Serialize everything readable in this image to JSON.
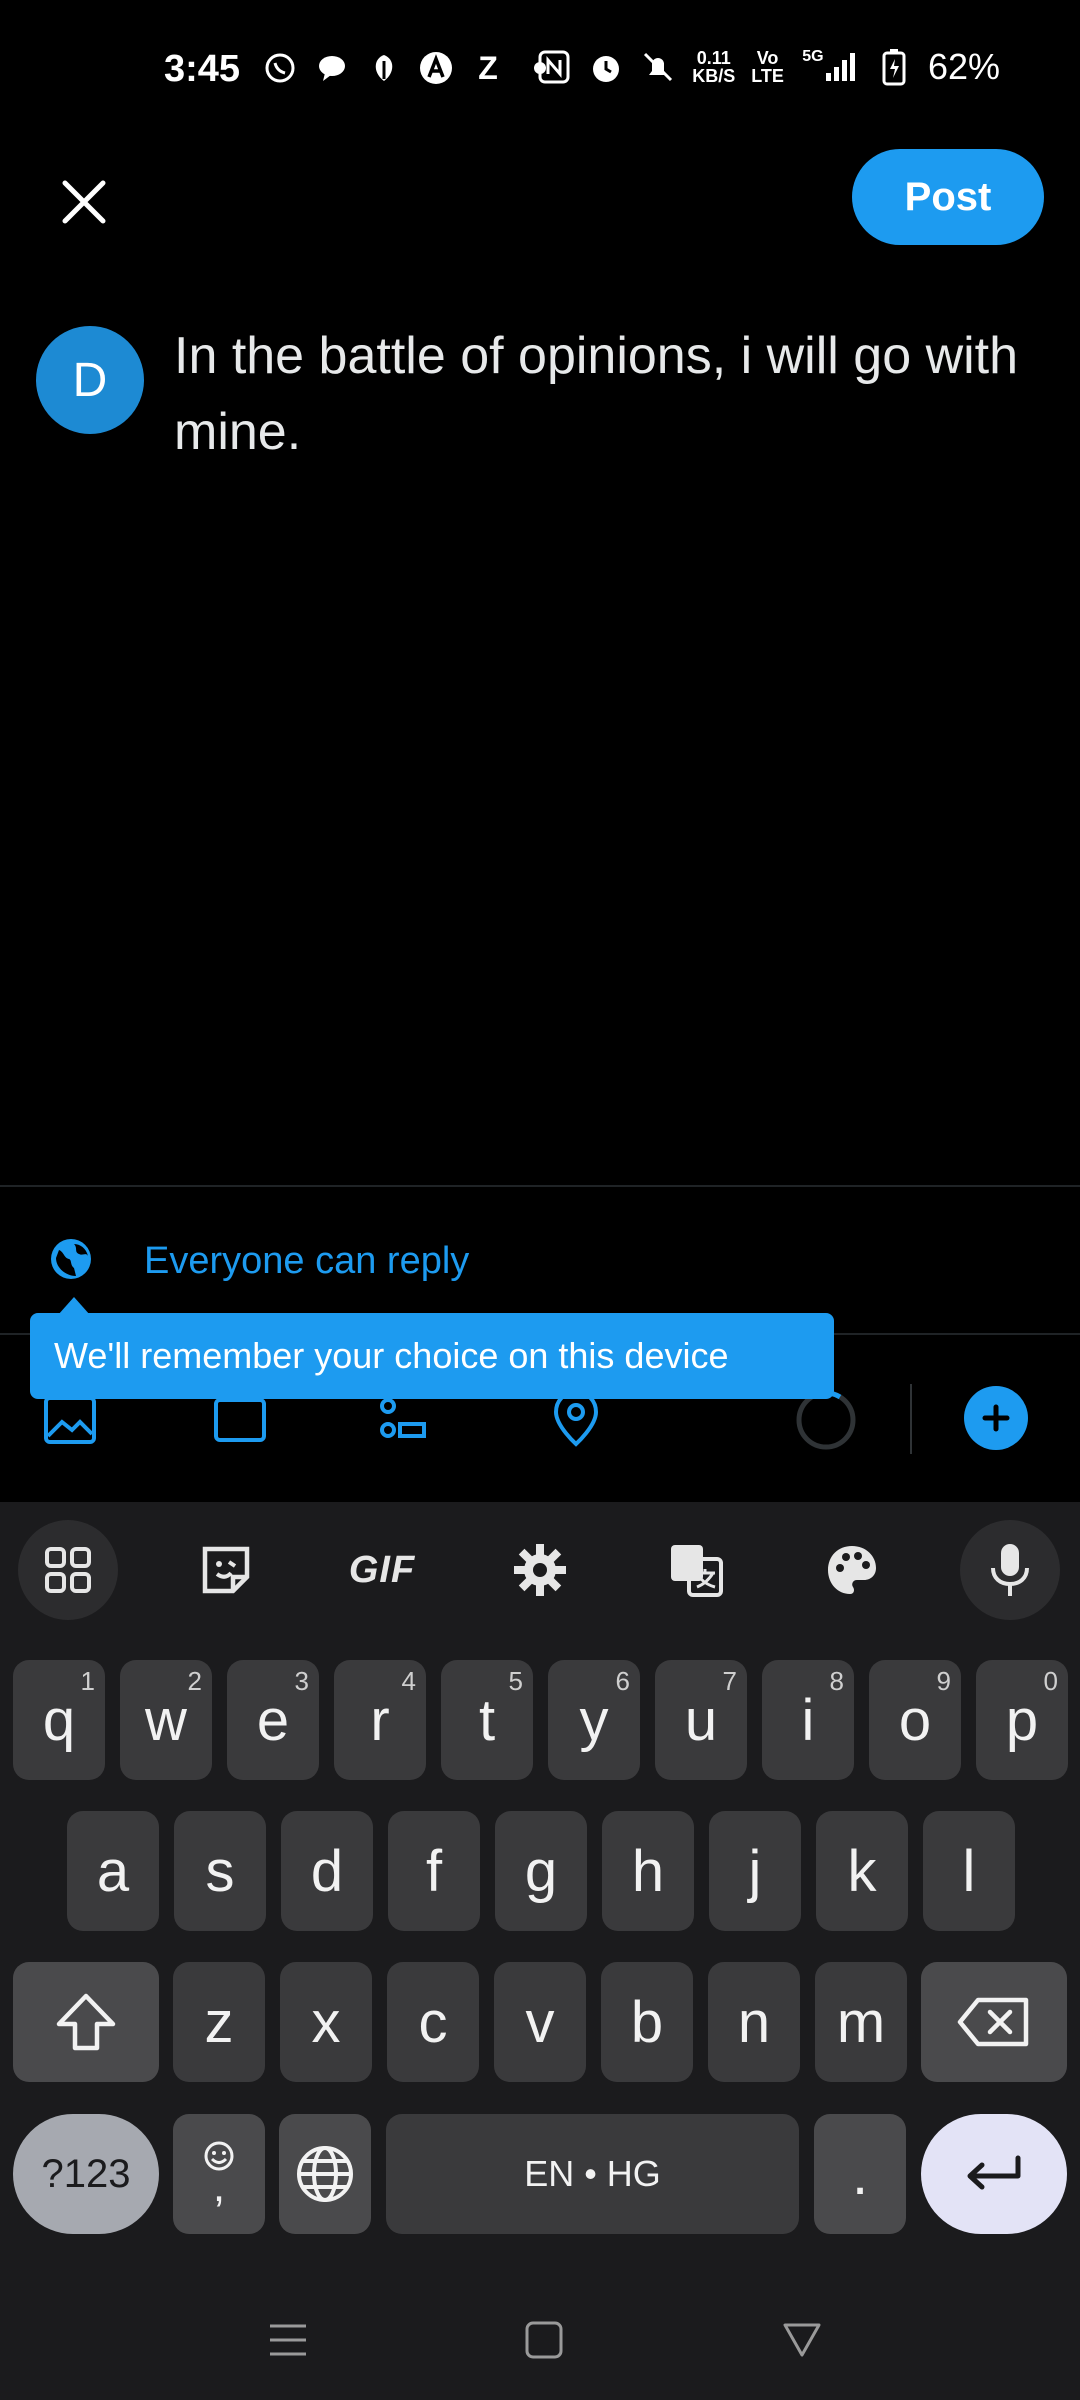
{
  "status_bar": {
    "time": "3:45",
    "left_icons": [
      "whatsapp-icon",
      "chat-bubble-icon",
      "leaf-icon",
      "a-logo-icon",
      "z-letter-icon",
      "dot-icon"
    ],
    "right_icons": [
      "nfc-icon",
      "alarm-icon",
      "mute-icon"
    ],
    "net_speed": "0.11",
    "net_unit": "KB/S",
    "volte_top": "Vo",
    "volte_bottom": "LTE",
    "network": "5G",
    "battery": "62%"
  },
  "header": {
    "post_label": "Post"
  },
  "composer": {
    "avatar_initial": "D",
    "text": "In the battle of opinions, i will go with mine."
  },
  "reply": {
    "label": "Everyone can reply"
  },
  "tooltip": {
    "text": "We'll remember your choice on this device"
  },
  "colors": {
    "accent": "#1d9bf0",
    "background": "#000000",
    "keyboard_bg": "#1b1b1d",
    "key_bg": "#3a3a3c"
  },
  "keyboard": {
    "row1": [
      {
        "k": "q",
        "h": "1"
      },
      {
        "k": "w",
        "h": "2"
      },
      {
        "k": "e",
        "h": "3"
      },
      {
        "k": "r",
        "h": "4"
      },
      {
        "k": "t",
        "h": "5"
      },
      {
        "k": "y",
        "h": "6"
      },
      {
        "k": "u",
        "h": "7"
      },
      {
        "k": "i",
        "h": "8"
      },
      {
        "k": "o",
        "h": "9"
      },
      {
        "k": "p",
        "h": "0"
      }
    ],
    "row2": [
      "a",
      "s",
      "d",
      "f",
      "g",
      "h",
      "j",
      "k",
      "l"
    ],
    "row3": [
      "z",
      "x",
      "c",
      "v",
      "b",
      "n",
      "m"
    ],
    "symbols_label": "?123",
    "comma_label": ",",
    "space_label": "EN • HG",
    "period_label": ".",
    "gif_label": "GIF"
  }
}
